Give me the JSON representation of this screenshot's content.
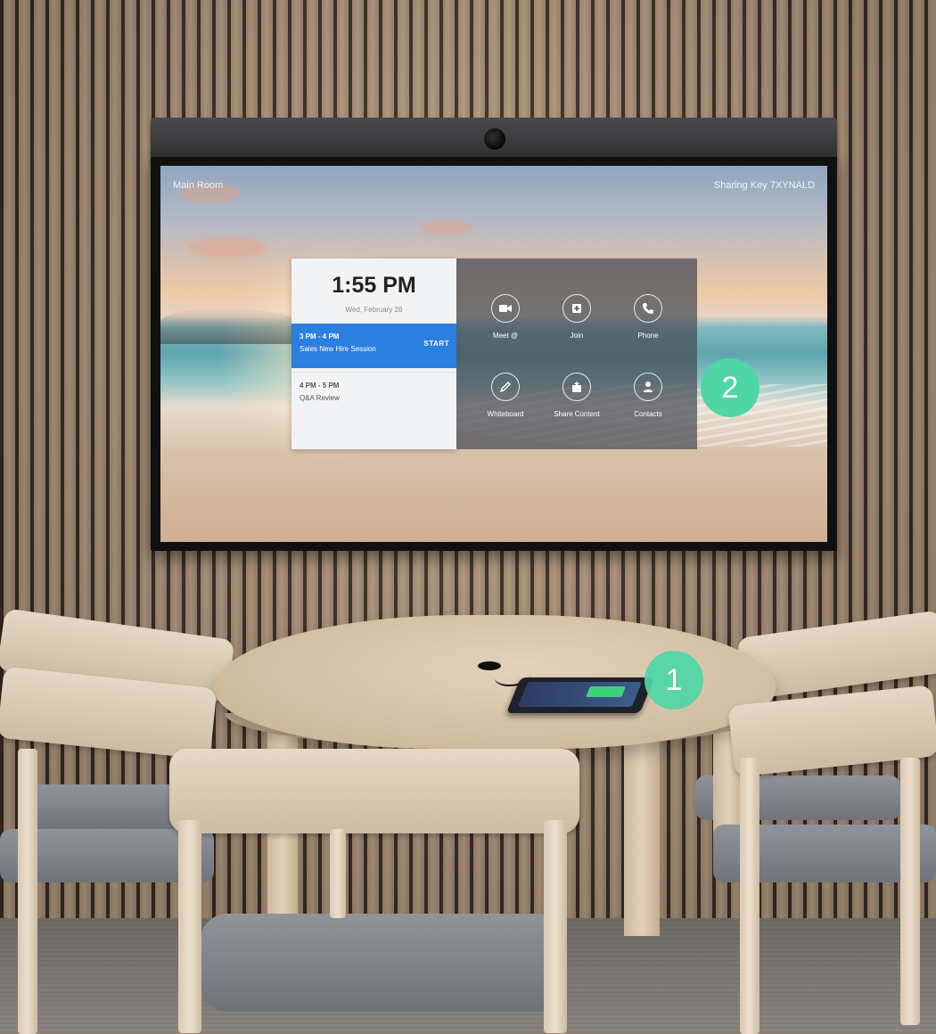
{
  "screen": {
    "room_name": "Main Room",
    "sharing_key": "Sharing Key 7XYNALD",
    "clock": "1:55 PM",
    "date": "Wed, February 26",
    "meetings": [
      {
        "time": "3 PM - 4 PM",
        "title": "Sales New Hire Session",
        "action": "START"
      },
      {
        "time": "4 PM - 5 PM",
        "title": "Q&A Review"
      }
    ],
    "actions": [
      {
        "label": "Meet @",
        "icon": "video-camera-icon"
      },
      {
        "label": "Join",
        "icon": "join-plus-icon"
      },
      {
        "label": "Phone",
        "icon": "phone-icon"
      },
      {
        "label": "Whiteboard",
        "icon": "pen-icon"
      },
      {
        "label": "Share Content",
        "icon": "share-upload-icon"
      },
      {
        "label": "Contacts",
        "icon": "person-icon"
      }
    ]
  },
  "callouts": {
    "controller_badge": "1",
    "screen_badge": "2"
  },
  "colors": {
    "accent_blue": "#2b7fe0",
    "badge_green": "#4fd6a6"
  }
}
